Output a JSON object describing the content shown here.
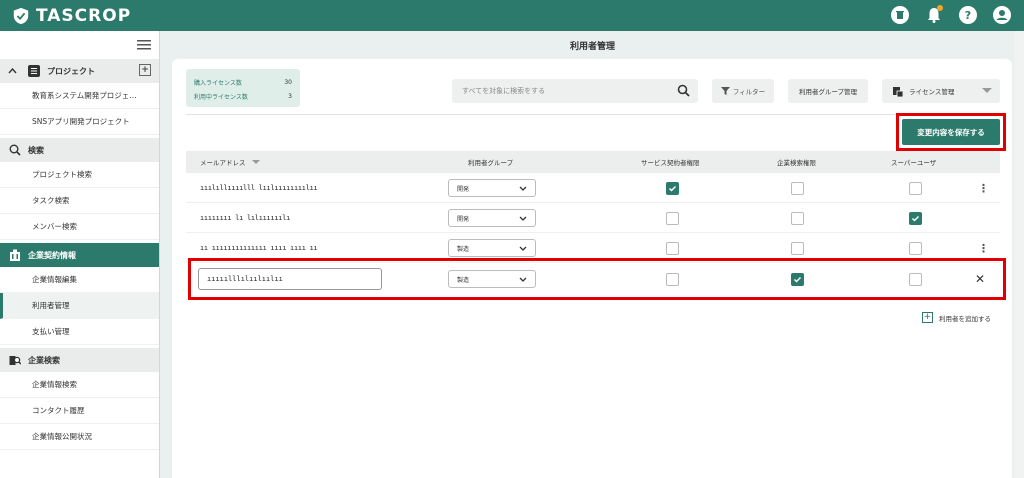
{
  "app": {
    "name": "TASCROP"
  },
  "colors": {
    "brand": "#2c7a6b",
    "highlight": "#e00000",
    "notification": "#f5a623"
  },
  "header_icons": [
    "trash-icon",
    "bell-icon",
    "help-icon",
    "user-icon"
  ],
  "sidebar": {
    "project_section": "プロジェクト",
    "projects": [
      "教育系システム開発プロジェ…",
      "SNSアプリ開発プロジェクト"
    ],
    "search_section": "検索",
    "search_items": [
      "プロジェクト検索",
      "タスク検索",
      "メンバー検索"
    ],
    "contract_section": "企業契約情報",
    "contract_items": [
      "企業情報編集",
      "利用者管理",
      "支払い管理"
    ],
    "company_search_section": "企業検索",
    "company_search_items": [
      "企業情報検索",
      "コンタクト履歴",
      "企業情報公開状況"
    ]
  },
  "page": {
    "title": "利用者管理"
  },
  "license": {
    "purchased_label": "購入ライセンス数",
    "purchased_value": "30",
    "in_use_label": "利用中ライセンス数",
    "in_use_value": "3"
  },
  "toolbar": {
    "search_placeholder": "すべてを対象に検索をする",
    "filter_label": "フィルター",
    "group_label": "利用者グループ管理",
    "license_label": "ライセンス管理",
    "save_label": "変更内容を保存する"
  },
  "table": {
    "headers": {
      "email": "メールアドレス",
      "group": "利用者グループ",
      "service": "サービス契約者権限",
      "search": "企業検索権限",
      "super": "スーパーユーザ"
    },
    "rows": [
      {
        "email": "ııılıllıııılll lıılıııııııılıı",
        "group": "開発",
        "service": true,
        "search": false,
        "super": false,
        "action": "⋮"
      },
      {
        "email": "ıııııııı lı lılıııııılı",
        "group": "開発",
        "service": false,
        "search": false,
        "super": true,
        "action": ""
      },
      {
        "email": "ıı ıııııııııııııı ıııı ıııı ıı",
        "group": "製造",
        "service": false,
        "search": false,
        "super": false,
        "action": "⋮"
      }
    ],
    "editing_row": {
      "email": "ııııılllılıılıılıı",
      "group": "製造",
      "service": false,
      "search": true,
      "super": false,
      "action": "✕"
    }
  },
  "add_user_label": "利用者を追加する"
}
